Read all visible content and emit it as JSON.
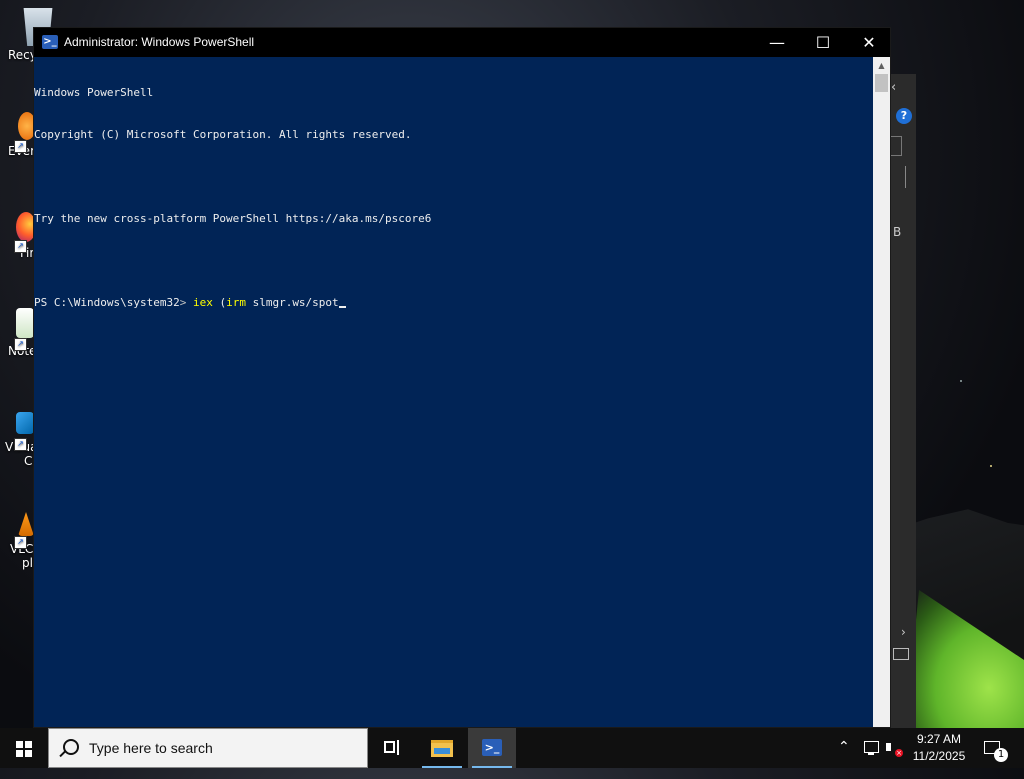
{
  "desktop": {
    "icons": [
      {
        "label": "Recy"
      },
      {
        "label": "Ever"
      },
      {
        "label": "Fir"
      },
      {
        "label": "Note"
      },
      {
        "label": "Visua"
      },
      {
        "label": "C"
      },
      {
        "label": "VLC"
      },
      {
        "label": "pl"
      }
    ]
  },
  "window": {
    "title": "Administrator: Windows PowerShell",
    "icon": "powershell-icon",
    "controls": {
      "minimize": "—",
      "maximize": "☐",
      "close": "✕"
    }
  },
  "console": {
    "lines": [
      "Windows PowerShell",
      "Copyright (C) Microsoft Corporation. All rights reserved.",
      "",
      "Try the new cross-platform PowerShell https://aka.ms/pscore6",
      ""
    ],
    "prompt": "PS C:\\Windows\\system32",
    "prompt_gt": ">",
    "command": "iex",
    "paren": "(",
    "subcommand": "irm",
    "argument": "slmgr.ws/spot",
    "colors": {
      "background": "#012456",
      "text": "#eeeeee",
      "command": "#ffff00"
    }
  },
  "background_window": {
    "help_icon": "?",
    "label_b": "B",
    "chevron_left": "‹",
    "chevron_right": "›"
  },
  "taskbar": {
    "search_placeholder": "Type here to search",
    "apps": [
      "task-view-icon",
      "file-explorer-icon",
      "powershell-icon"
    ],
    "tray": {
      "chevron": "⌃",
      "time": "9:27 AM",
      "date": "11/2/2025",
      "notification_count": "1"
    }
  }
}
